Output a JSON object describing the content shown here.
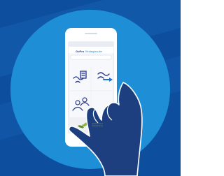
{
  "app": {
    "brand": "GoPro",
    "subtitle": "Strategiesuite"
  },
  "footer": {
    "line1": "Bodenschutz",
    "line2": "Brandenburg"
  },
  "colors": {
    "background_dark": "#0d4f9e",
    "background_stripe": "#1a67b8",
    "circle": "#1e8fd6",
    "phone_body": "#ffffff",
    "screen_bg": "#ffffff",
    "header_bar": "#2f3e9e",
    "hand_fill": "#1d3f80",
    "hand_outline": "#ffffff",
    "icon_stroke": "#2b3a8c"
  },
  "icons": [
    {
      "name": "document-route-icon"
    },
    {
      "name": "arrow-route-icon"
    },
    {
      "name": "people-icon"
    },
    {
      "name": "plant-logo-icon"
    }
  ]
}
